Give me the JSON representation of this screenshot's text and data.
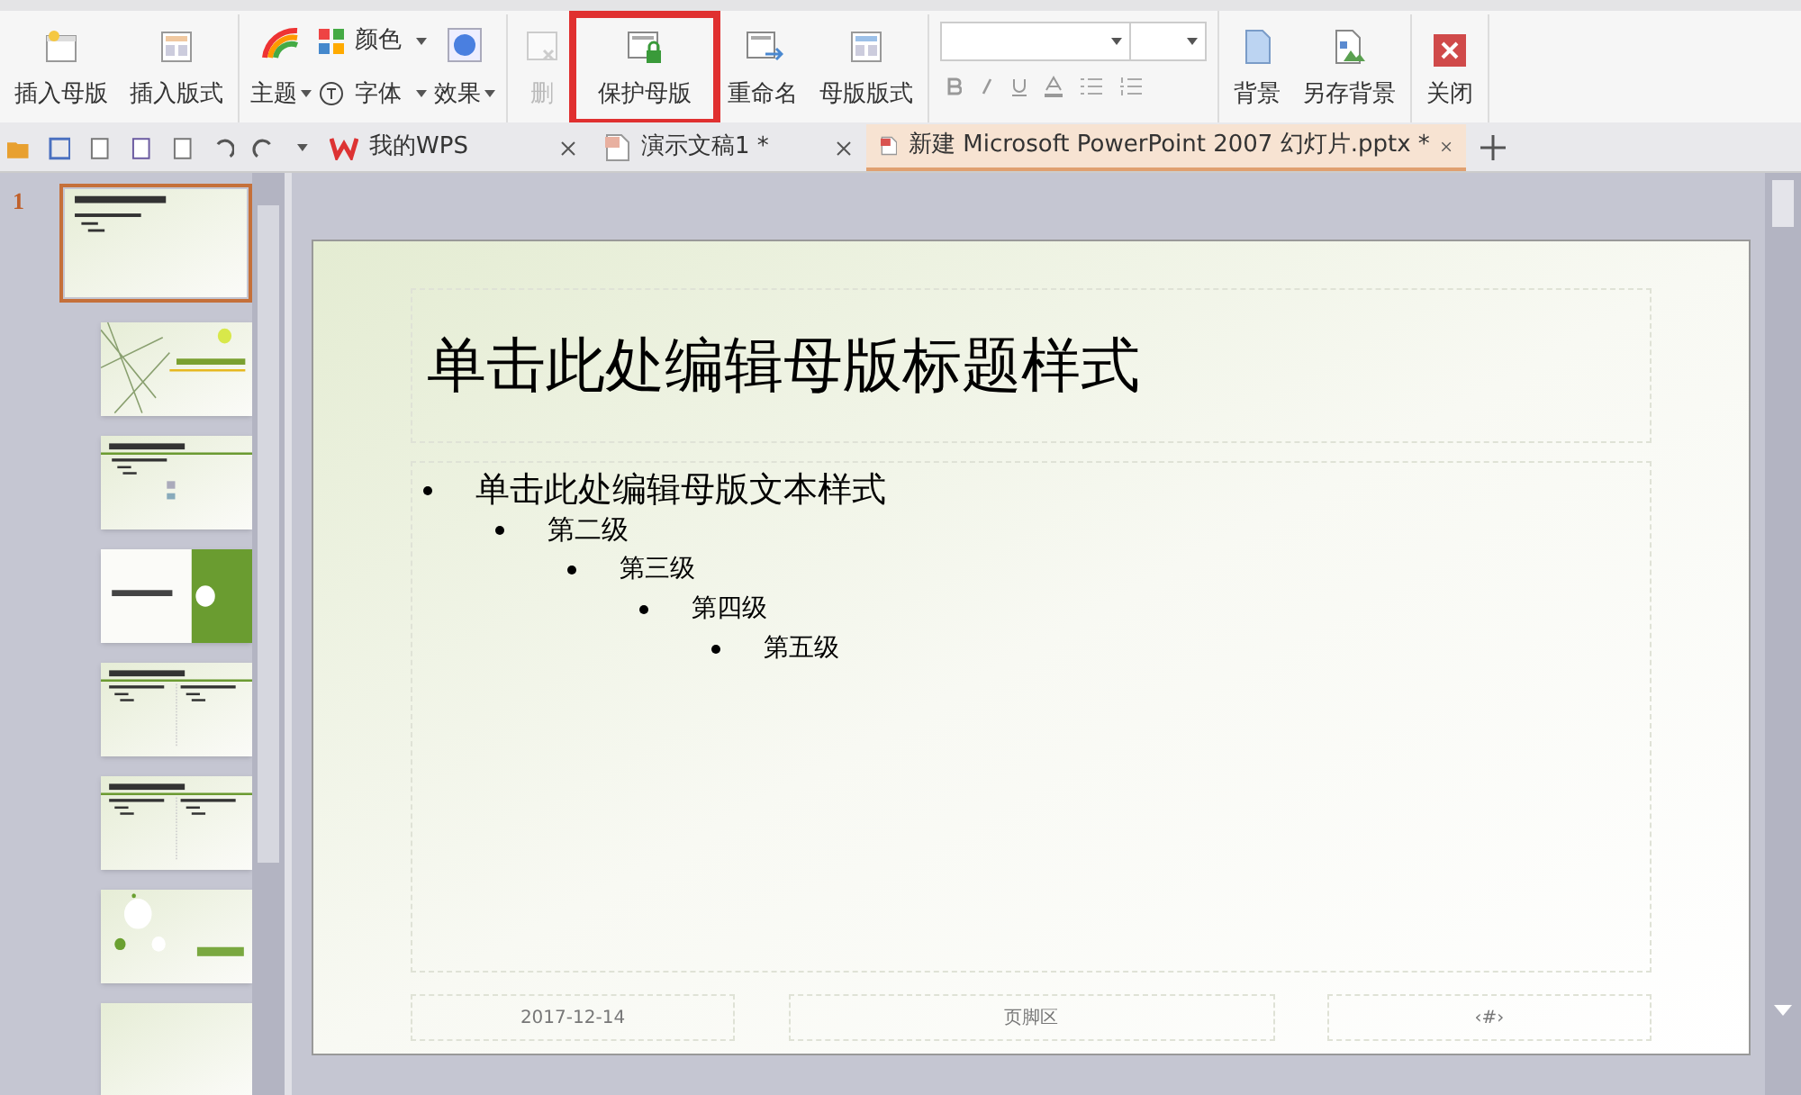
{
  "ribbon": {
    "groups": [
      {
        "kind": "large",
        "items": [
          {
            "label": "插入母版",
            "disabled": false,
            "highlighted": false
          },
          {
            "label": "插入版式",
            "disabled": false,
            "highlighted": false
          }
        ]
      },
      {
        "kind": "theme",
        "theme": {
          "label": "主题"
        },
        "small": [
          {
            "label": "颜色"
          },
          {
            "label": "字体"
          }
        ],
        "effects": {
          "label": "效果"
        }
      },
      {
        "kind": "large",
        "items": [
          {
            "label": "删",
            "disabled": true,
            "highlighted": false
          },
          {
            "label": "保护母版",
            "disabled": false,
            "highlighted": true
          },
          {
            "label": "重命名",
            "disabled": false,
            "highlighted": false
          },
          {
            "label": "母版版式",
            "disabled": false,
            "highlighted": false
          }
        ]
      },
      {
        "kind": "format"
      },
      {
        "kind": "large",
        "items": [
          {
            "label": "背景",
            "disabled": false,
            "highlighted": false
          },
          {
            "label": "另存背景",
            "disabled": false,
            "highlighted": false
          }
        ]
      },
      {
        "kind": "large",
        "items": [
          {
            "label": "关闭",
            "disabled": false,
            "highlighted": false
          }
        ]
      }
    ]
  },
  "tabs": [
    {
      "label": "我的WPS",
      "selected": false
    },
    {
      "label": "演示文稿1 *",
      "selected": false
    },
    {
      "label": "新建 Microsoft PowerPoint 2007 幻灯片.pptx *",
      "selected": true
    }
  ],
  "thumbnails": [
    {
      "kind": "master",
      "selected": true,
      "number": "1"
    },
    {
      "kind": "bamboo",
      "selected": false
    },
    {
      "kind": "content",
      "selected": false
    },
    {
      "kind": "section",
      "selected": false
    },
    {
      "kind": "two",
      "selected": false
    },
    {
      "kind": "two",
      "selected": false
    },
    {
      "kind": "bubbles",
      "selected": false
    },
    {
      "kind": "blank",
      "selected": false
    }
  ],
  "slide": {
    "title": "单击此处编辑母版标题样式",
    "body": [
      {
        "text": "单击此处编辑母版文本样式",
        "children": [
          {
            "text": "第二级",
            "children": [
              {
                "text": "第三级",
                "children": [
                  {
                    "text": "第四级",
                    "children": [
                      {
                        "text": "第五级"
                      }
                    ]
                  }
                ]
              }
            ]
          }
        ]
      }
    ],
    "footer": {
      "date": "2017-12-14",
      "footer": "页脚区",
      "number": "‹#›"
    }
  }
}
